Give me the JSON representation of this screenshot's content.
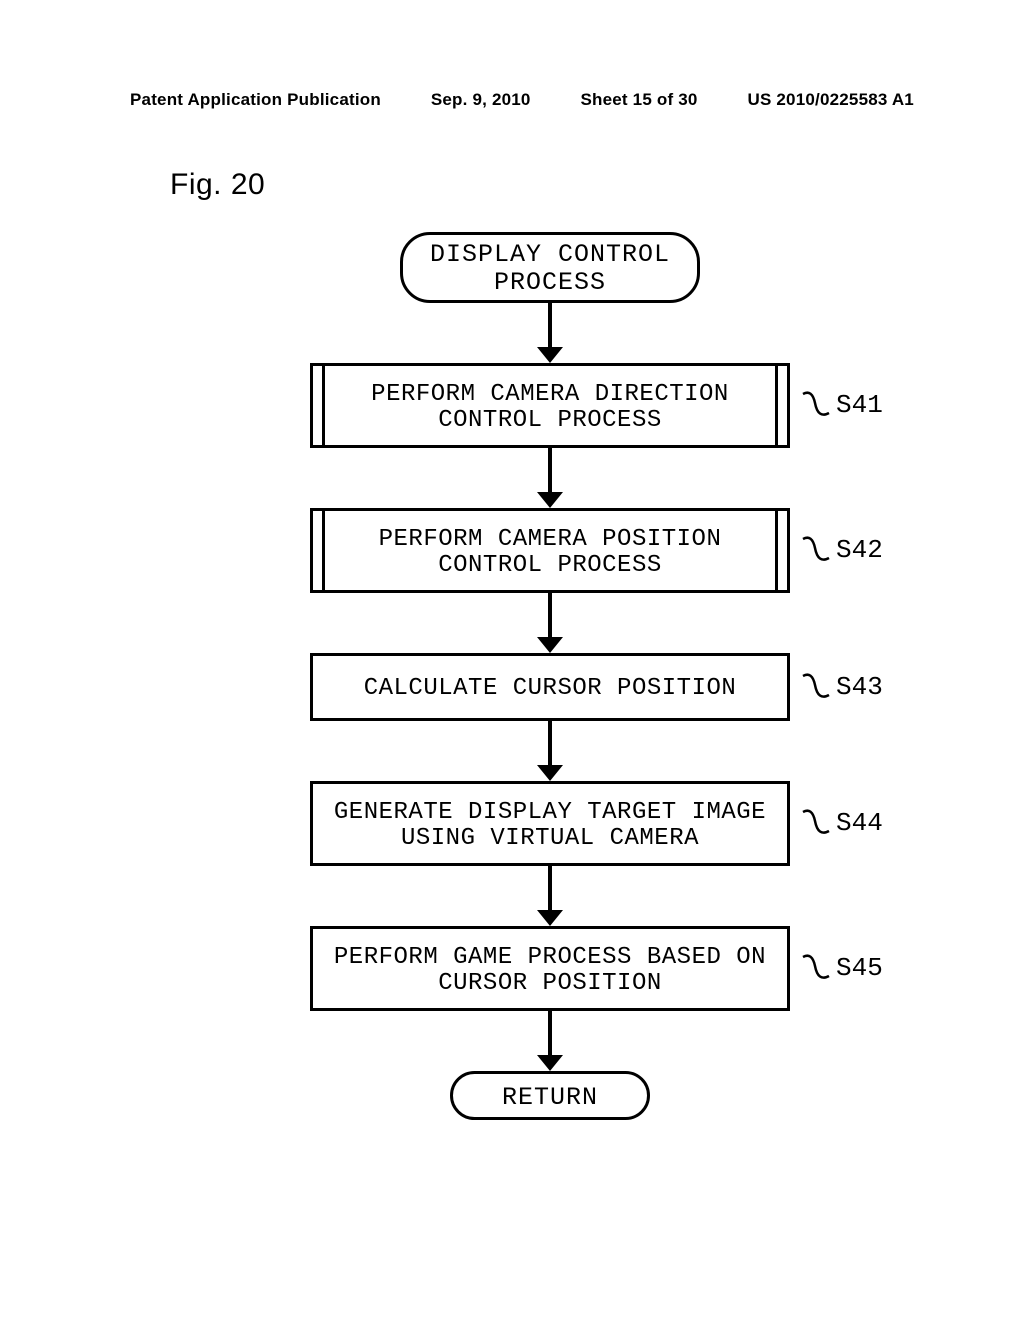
{
  "header": {
    "pub_type": "Patent Application Publication",
    "date": "Sep. 9, 2010",
    "sheet": "Sheet 15 of 30",
    "pub_number": "US 2010/0225583 A1"
  },
  "figure_label": "Fig. 20",
  "chart_data": {
    "type": "flowchart",
    "title": "DISPLAY CONTROL PROCESS",
    "steps": [
      {
        "id": "S41",
        "text": "PERFORM CAMERA DIRECTION CONTROL PROCESS",
        "kind": "predefined-process"
      },
      {
        "id": "S42",
        "text": "PERFORM CAMERA POSITION CONTROL PROCESS",
        "kind": "predefined-process"
      },
      {
        "id": "S43",
        "text": "CALCULATE CURSOR POSITION",
        "kind": "process"
      },
      {
        "id": "S44",
        "text": "GENERATE DISPLAY TARGET IMAGE USING VIRTUAL CAMERA",
        "kind": "process"
      },
      {
        "id": "S45",
        "text": "PERFORM GAME PROCESS BASED ON CURSOR POSITION",
        "kind": "process"
      }
    ],
    "return": "RETURN"
  },
  "flow": {
    "start_l1": "DISPLAY CONTROL",
    "start_l2": "PROCESS",
    "s41_l1": "PERFORM CAMERA DIRECTION",
    "s41_l2": "CONTROL PROCESS",
    "s41_id": "S41",
    "s42_l1": "PERFORM CAMERA POSITION",
    "s42_l2": "CONTROL PROCESS",
    "s42_id": "S42",
    "s43": "CALCULATE CURSOR POSITION",
    "s43_id": "S43",
    "s44_l1": "GENERATE DISPLAY TARGET IMAGE",
    "s44_l2": "USING VIRTUAL CAMERA",
    "s44_id": "S44",
    "s45_l1": "PERFORM GAME PROCESS BASED ON",
    "s45_l2": "CURSOR POSITION",
    "s45_id": "S45",
    "return": "RETURN"
  }
}
